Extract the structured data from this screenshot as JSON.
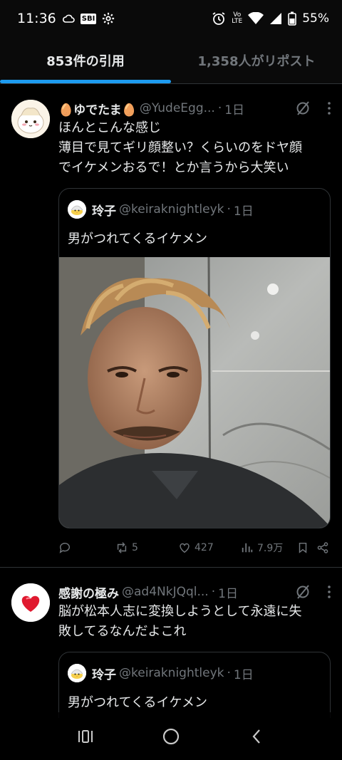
{
  "status_bar": {
    "time": "11:36",
    "sbi": "SBI",
    "volte_top": "Vo",
    "volte_bottom": "LTE",
    "battery": "55%"
  },
  "tabs": [
    {
      "label": "853件の引用",
      "active": true
    },
    {
      "label": "1,358人がリポスト",
      "active": false
    }
  ],
  "posts": [
    {
      "display_name": "🥚ゆでたま🥚",
      "handle": "@YudeEgg...",
      "time": "1日",
      "text_lines": [
        "ほんとこんな感じ",
        "薄目で見てギリ顔整い？くらいのをドヤ顔",
        "でイケメンおるで！とか言うから大笑い"
      ],
      "quote": {
        "display_name": "玲子",
        "handle": "@keiraknightleyk",
        "time": "1日",
        "text": "男がつれてくるイケメン"
      },
      "actions": {
        "reply": "",
        "repost": "5",
        "like": "427",
        "views": "7.9万"
      }
    },
    {
      "display_name": "感謝の極み",
      "handle": "@ad4NkJQql...",
      "time": "1日",
      "text_lines": [
        "脳が松本人志に変換しようとして永遠に失",
        "敗してるなんだよこれ"
      ],
      "quote": {
        "display_name": "玲子",
        "handle": "@keiraknightleyk",
        "time": "1日",
        "text": "男がつれてくるイケメン"
      }
    }
  ],
  "colors": {
    "accent": "#1d9bf0",
    "text": "#e7e9ea",
    "muted": "#71767b",
    "border": "#2f3336"
  }
}
